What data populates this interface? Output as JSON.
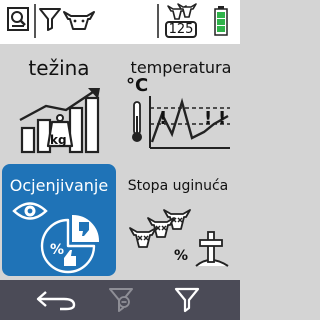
{
  "header": {
    "animal_count": "125",
    "battery_level": 1.0,
    "battery_color": "#2fb34a"
  },
  "tiles": [
    {
      "label": "težina",
      "icon": "scale-growth-chart-icon",
      "badge": "kg",
      "selected": false
    },
    {
      "label": "temperatura",
      "icon": "temperature-chart-icon",
      "unit": "°C",
      "selected": false
    },
    {
      "label": "Ocjenjivanje",
      "icon": "eye-pie-chart-icon",
      "selected": true
    },
    {
      "label": "Stopa uginuća",
      "icon": "cows-grave-icon",
      "badge": "%",
      "selected": false
    }
  ],
  "footer": {
    "icons": [
      "back-arrow-icon",
      "clear-filter-icon",
      "filter-icon"
    ]
  },
  "colors": {
    "accent": "#1f73b7",
    "bottom_bar": "#4b4b57",
    "background": "#d4d4d4"
  }
}
